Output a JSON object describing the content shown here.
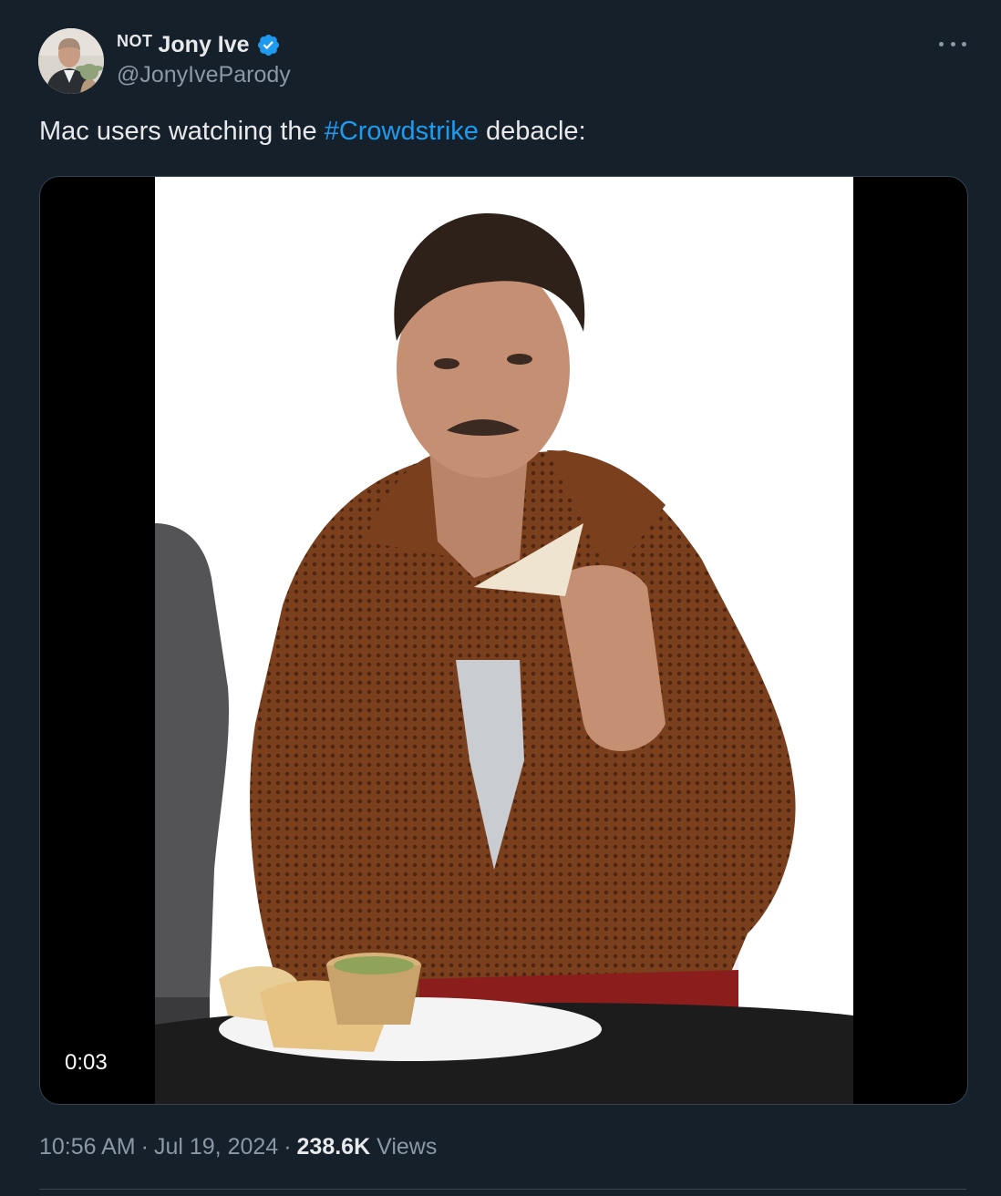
{
  "author": {
    "name_prefix": "NOT",
    "display_name": "Jony Ive",
    "handle": "@JonyIveParody",
    "verified": true
  },
  "tweet": {
    "text_before": "Mac users watching the ",
    "hashtag": "#Crowdstrike",
    "text_after": " debacle:"
  },
  "media": {
    "type": "video",
    "timecode": "0:03"
  },
  "meta": {
    "time": "10:56 AM",
    "separator": "·",
    "date": "Jul 19, 2024",
    "views_count": "238.6K",
    "views_label": "Views"
  },
  "colors": {
    "background": "#15202b",
    "text": "#e7e9ea",
    "secondary": "#8b98a5",
    "accent": "#1d9bf0",
    "border": "#38444d"
  },
  "icons": {
    "verified": "verified-badge-icon",
    "more": "more-options-icon"
  }
}
